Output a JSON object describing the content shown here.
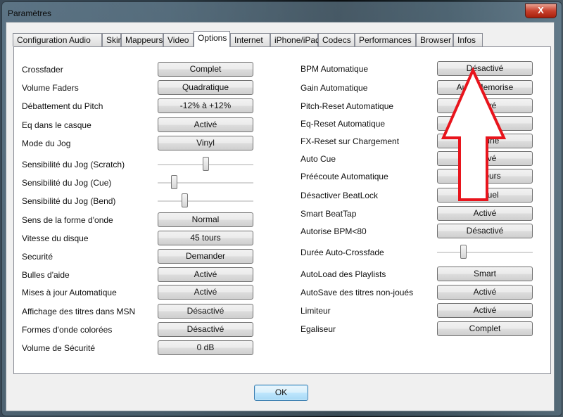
{
  "window": {
    "title": "Paramètres",
    "close_label": "X"
  },
  "tabs": [
    {
      "label": "Configuration Audio"
    },
    {
      "label": "Skin"
    },
    {
      "label": "Mappeurs"
    },
    {
      "label": "Video"
    },
    {
      "label": "Options",
      "active": true
    },
    {
      "label": "Internet"
    },
    {
      "label": "iPhone/iPad"
    },
    {
      "label": "Codecs"
    },
    {
      "label": "Performances"
    },
    {
      "label": "Browser"
    },
    {
      "label": "Infos"
    }
  ],
  "left_settings": [
    {
      "label": "Crossfader",
      "value": "Complet"
    },
    {
      "label": "Volume Faders",
      "value": "Quadratique"
    },
    {
      "label": "Débattement du Pitch",
      "value": "-12% à +12%"
    },
    {
      "label": "Eq dans le casque",
      "value": "Activé"
    },
    {
      "label": "Mode du Jog",
      "value": "Vinyl"
    },
    {
      "label": "Sensibilité du Jog (Scratch)",
      "slider": 0.5
    },
    {
      "label": "Sensibilité du Jog (Cue)",
      "slider": 0.15
    },
    {
      "label": "Sensibilité du Jog (Bend)",
      "slider": 0.27
    },
    {
      "label": "Sens de la forme d'onde",
      "value": "Normal"
    },
    {
      "label": "Vitesse du disque",
      "value": "45 tours"
    },
    {
      "label": "Securité",
      "value": "Demander"
    },
    {
      "label": "Bulles d'aide",
      "value": "Activé"
    },
    {
      "label": "Mises à jour Automatique",
      "value": "Activé"
    },
    {
      "label": "Affichage des titres dans MSN",
      "value": "Désactivé"
    },
    {
      "label": "Formes d'onde colorées",
      "value": "Désactivé"
    },
    {
      "label": "Volume de Sécurité",
      "value": "0 dB"
    }
  ],
  "right_settings": [
    {
      "label": "BPM Automatique",
      "value": "Désactivé"
    },
    {
      "label": "Gain Automatique",
      "value": "Auto Memorise"
    },
    {
      "label": "Pitch-Reset Automatique",
      "value": "Activé"
    },
    {
      "label": "Eq-Reset Automatique",
      "value": "Activé"
    },
    {
      "label": "FX-Reset sur Chargement",
      "value": "Aucune"
    },
    {
      "label": "Auto Cue",
      "value": "Activé"
    },
    {
      "label": "Préécoute Automatique",
      "value": "Toujours"
    },
    {
      "label": "Désactiver BeatLock",
      "value": "Manuel"
    },
    {
      "label": "Smart BeatTap",
      "value": "Activé"
    },
    {
      "label": "Autorise BPM<80",
      "value": "Désactivé"
    },
    {
      "label": "Durée Auto-Crossfade",
      "slider": 0.26
    },
    {
      "label": "AutoLoad des Playlists",
      "value": "Smart"
    },
    {
      "label": "AutoSave des titres non-joués",
      "value": "Activé"
    },
    {
      "label": "Limiteur",
      "value": "Activé"
    },
    {
      "label": "Egaliseur",
      "value": "Complet"
    }
  ],
  "footer": {
    "ok_label": "OK"
  },
  "annotation": {
    "arrow_color": "#e8141c"
  }
}
